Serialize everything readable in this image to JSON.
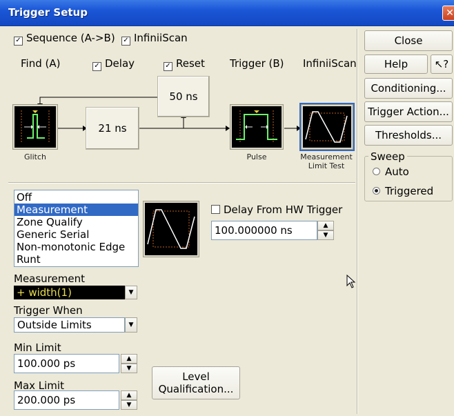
{
  "window": {
    "title": "Trigger Setup"
  },
  "options": {
    "sequence": "Sequence (A->B)",
    "infiniiscan": "InfiniiScan"
  },
  "headers": {
    "find": "Find (A)",
    "delay": "Delay",
    "reset": "Reset",
    "trigger": "Trigger (B)",
    "infiniiscan": "InfiniiScan"
  },
  "flow": {
    "reset_time": "50 ns",
    "delay_time": "21 ns",
    "glitch_label": "Glitch",
    "pulse_label": "Pulse",
    "mlt_label_1": "Measurement",
    "mlt_label_2": "Limit Test"
  },
  "trigger_list": {
    "items": [
      "Off",
      "Measurement",
      "Zone Qualify",
      "Generic Serial",
      "Non-monotonic Edge",
      "Runt"
    ],
    "selected_index": 1
  },
  "hw_trigger": {
    "label": "Delay From HW Trigger",
    "value": "100.000000 ns"
  },
  "measurement": {
    "label": "Measurement",
    "value": "+ width(1)"
  },
  "trigger_when": {
    "label": "Trigger When",
    "value": "Outside Limits"
  },
  "min_limit": {
    "label": "Min Limit",
    "value": "100.000 ps"
  },
  "max_limit": {
    "label": "Max Limit",
    "value": "200.000 ps"
  },
  "level_button": {
    "line1": "Level",
    "line2": "Qualification..."
  },
  "side": {
    "close": "Close",
    "help": "Help",
    "whats_this": "↖?",
    "conditioning": "Conditioning...",
    "trigger_action": "Trigger Action...",
    "thresholds": "Thresholds..."
  },
  "sweep": {
    "label": "Sweep",
    "auto": "Auto",
    "triggered": "Triggered",
    "selected": "Triggered"
  }
}
